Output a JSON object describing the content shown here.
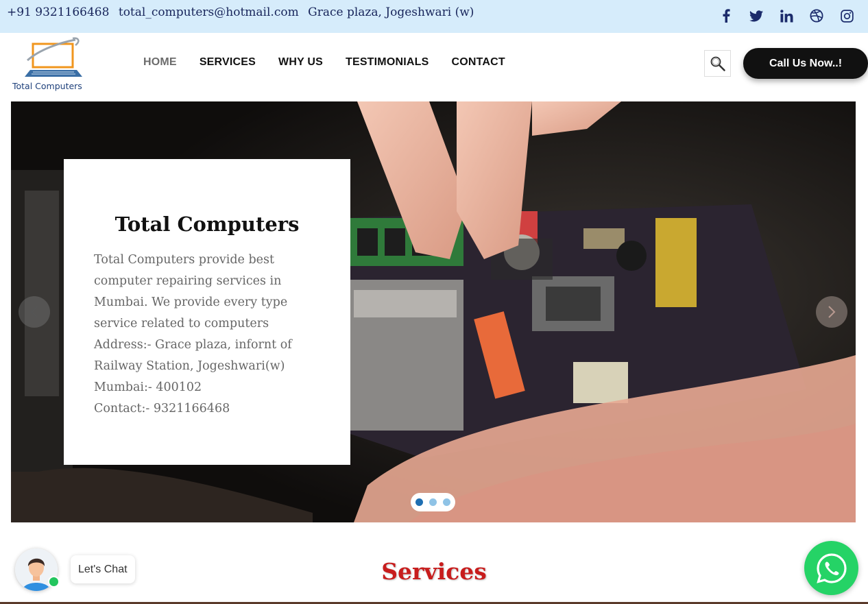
{
  "topbar": {
    "phone": "+91 9321166468",
    "email": "total_computers@hotmail.com",
    "address": "Grace plaza, Jogeshwari (w)",
    "social": [
      "facebook-icon",
      "twitter-icon",
      "linkedin-icon",
      "dribbble-icon",
      "instagram-icon"
    ]
  },
  "header": {
    "logo_text": "Total Computers",
    "nav": [
      "HOME",
      "SERVICES",
      "WHY US",
      "TESTIMONIALS",
      "CONTACT"
    ],
    "active_nav": "HOME",
    "call_button": "Call Us Now..!"
  },
  "hero": {
    "title": "Total Computers",
    "lines": [
      "Total Computers provide best",
      "computer repairing services in",
      "Mumbai. We provide every type",
      "service related to computers",
      "Address:- Grace plaza, infornt of",
      "Railway Station, Jogeshwari(w)",
      "Mumbai:- 400102",
      "Contact:- 9321166468"
    ],
    "slides": 3,
    "active_slide": 1
  },
  "section": {
    "title": "Services"
  },
  "chat": {
    "label": "Let's Chat"
  },
  "colors": {
    "topbar_bg": "#d6ecfb",
    "topbar_text": "#17245a",
    "services_title": "#c81d1d",
    "whatsapp": "#25d366"
  }
}
